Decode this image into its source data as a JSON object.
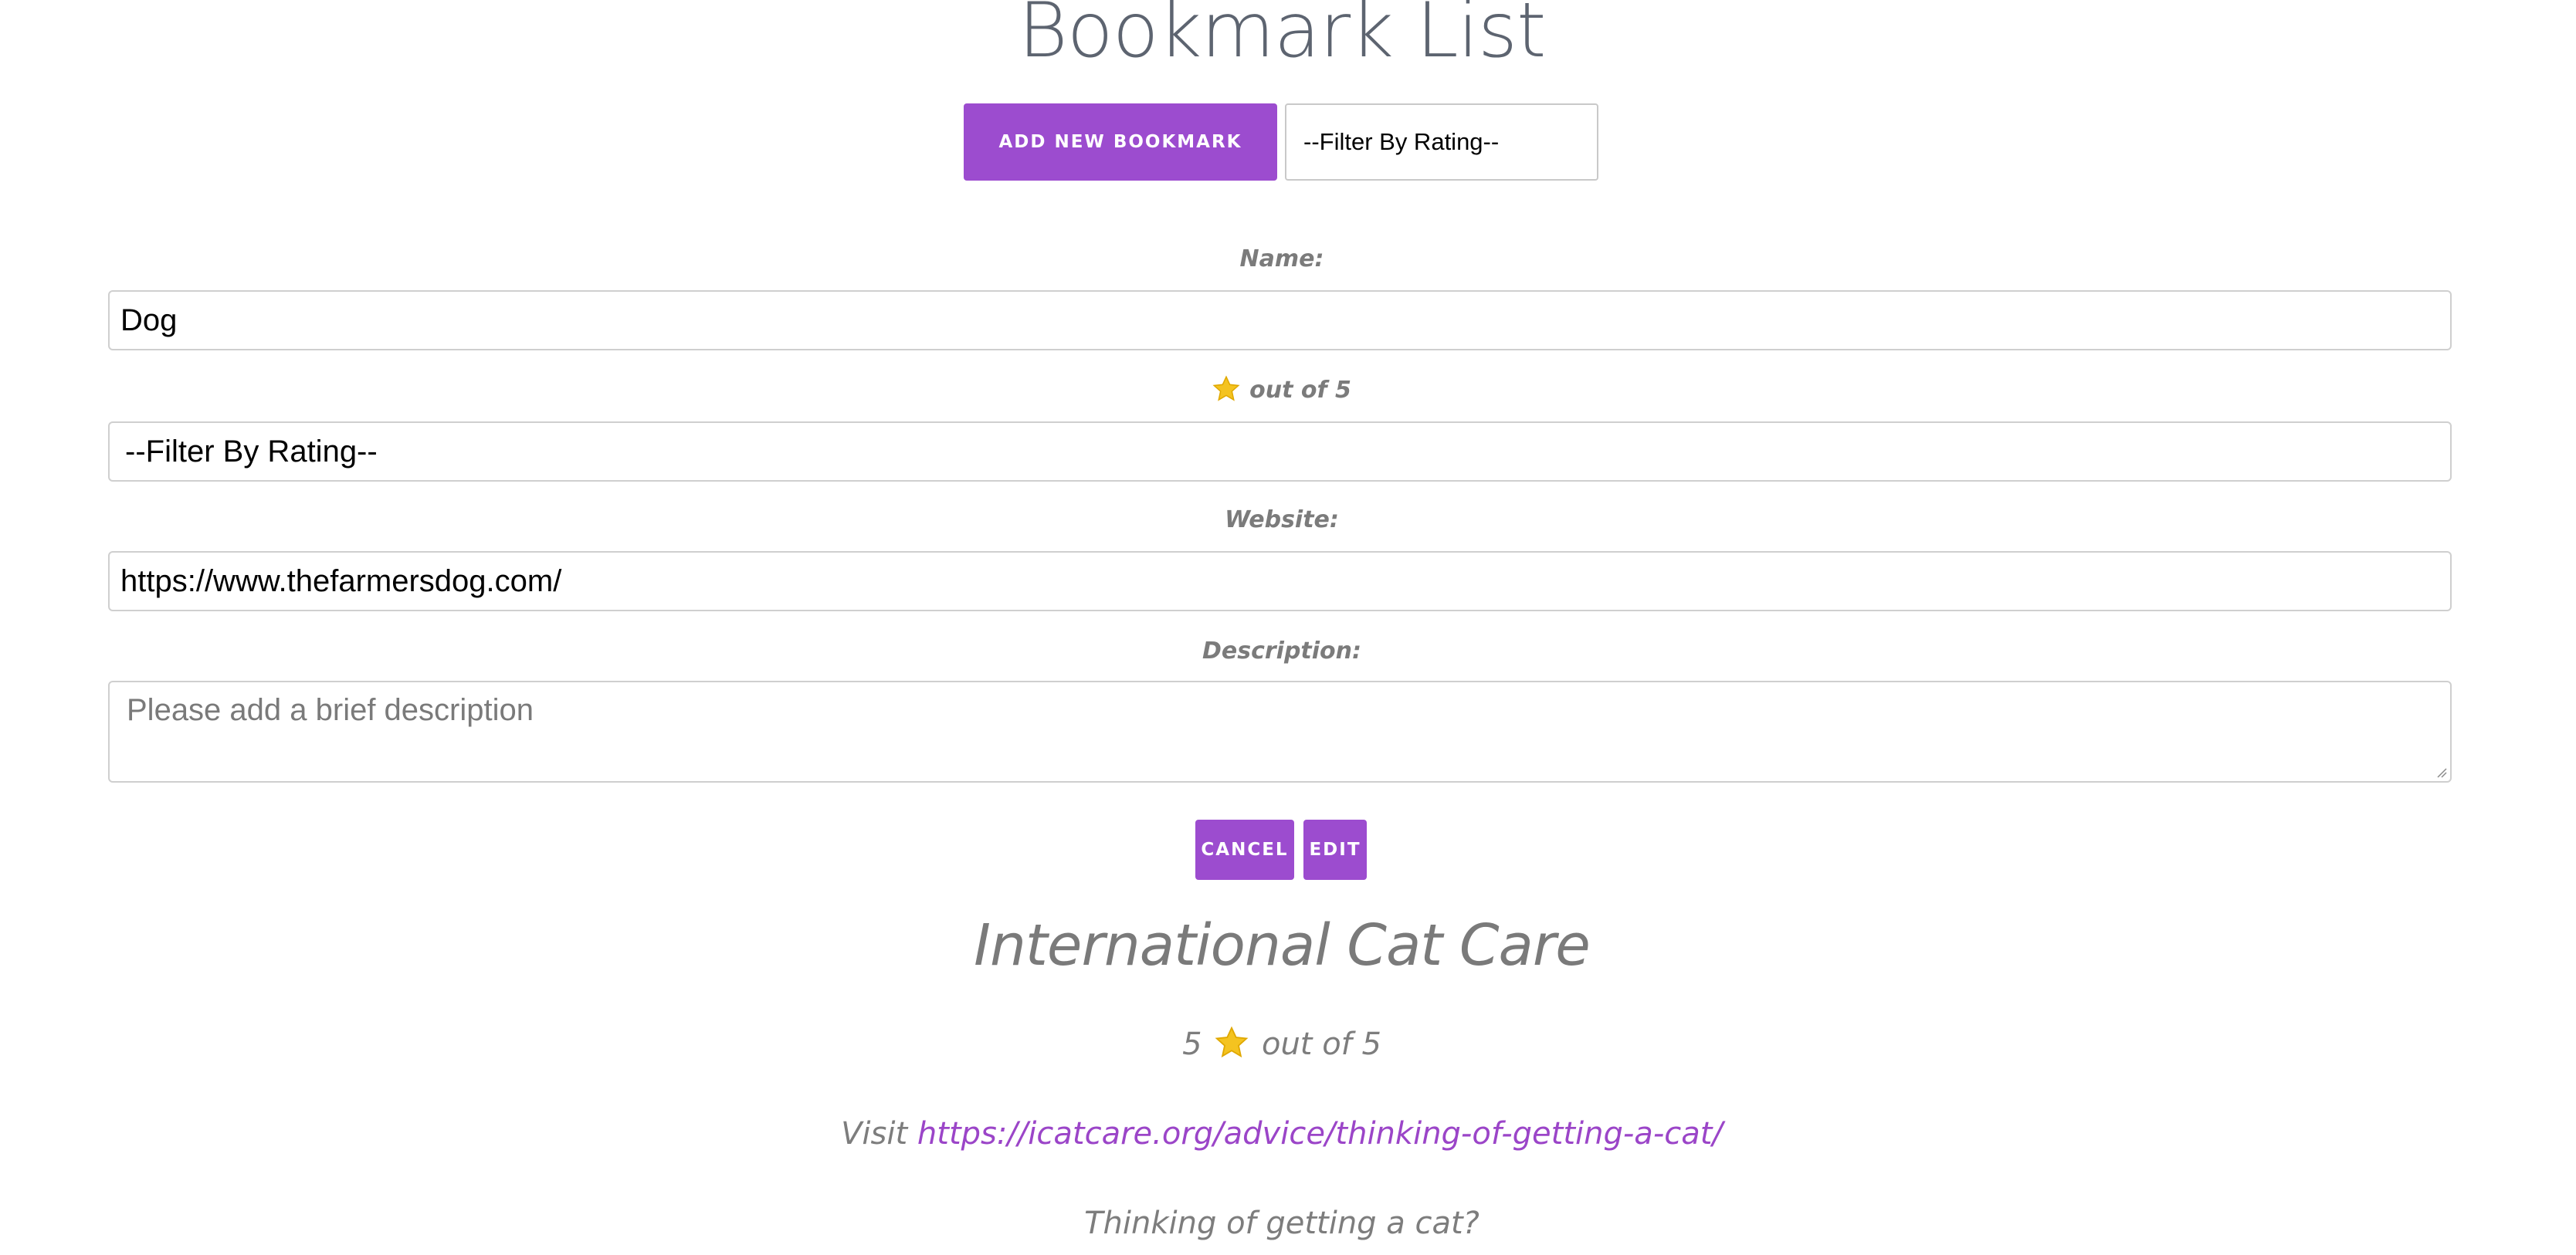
{
  "page": {
    "title": "Bookmark List"
  },
  "toolbar": {
    "add_label": "ADD NEW BOOKMARK",
    "filter_selected": "--Filter By Rating--"
  },
  "form": {
    "name_label": "Name:",
    "name_value": "Dog",
    "rating_label": "out of 5",
    "rating_selected": "--Filter By Rating--",
    "website_label": "Website:",
    "website_value": "https://www.thefarmersdog.com/",
    "description_label": "Description:",
    "description_placeholder": "Please add a brief description",
    "cancel_label": "CANCEL",
    "edit_label": "EDIT"
  },
  "bookmark": {
    "title": "International Cat Care",
    "rating": "5",
    "rating_suffix": "out of 5",
    "visit_prefix": "Visit",
    "url": "https://icatcare.org/advice/thinking-of-getting-a-cat/",
    "description": "Thinking of getting a cat?"
  },
  "colors": {
    "accent": "#9c4ccf",
    "link": "#9b45c8",
    "title_text": "#5d6470",
    "muted_text": "#7b7b7b",
    "star": "#f4c320"
  },
  "icons": {
    "rating_star": "star-icon",
    "resize_handle": "resize-grip-icon"
  }
}
